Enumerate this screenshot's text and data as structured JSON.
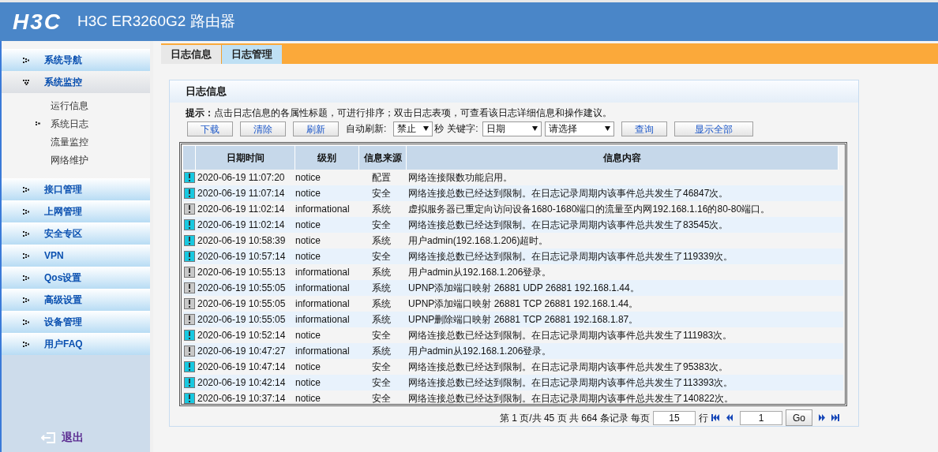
{
  "header": {
    "logo": "H3C",
    "title": "H3C ER3260G2 路由器"
  },
  "tabs": [
    {
      "label": "日志信息",
      "selected": true
    },
    {
      "label": "日志管理",
      "selected": false
    }
  ],
  "sidebar": {
    "items": [
      {
        "label": "系统导航",
        "expanded": false
      },
      {
        "label": "系统监控",
        "expanded": true,
        "children": [
          {
            "label": "运行信息",
            "selected": false
          },
          {
            "label": "系统日志",
            "selected": true
          },
          {
            "label": "流量监控",
            "selected": false
          },
          {
            "label": "网络维护",
            "selected": false
          }
        ]
      },
      {
        "label": "接口管理",
        "expanded": false
      },
      {
        "label": "上网管理",
        "expanded": false
      },
      {
        "label": "安全专区",
        "expanded": false
      },
      {
        "label": "VPN",
        "expanded": false
      },
      {
        "label": "Qos设置",
        "expanded": false
      },
      {
        "label": "高级设置",
        "expanded": false
      },
      {
        "label": "设备管理",
        "expanded": false
      },
      {
        "label": "用户FAQ",
        "expanded": false
      }
    ],
    "logout": "退出"
  },
  "panel": {
    "title": "日志信息",
    "hint": "**提示：**点击日志信息的各属性标题，可进行排序；双击日志表项，可查看该日志详细信息和操作建议。",
    "buttons": [
      "下载",
      "清除",
      "刷新"
    ],
    "auto_refresh_label": "自动刷新:",
    "auto_refresh_value": "禁止",
    "seconds_label": "秒",
    "keyword_label": "关键字:",
    "keyword_value": "日期",
    "condition_value": "请选择",
    "query_button": "查询",
    "show_all_button": "显示全部"
  },
  "table": {
    "columns": [
      "日期时间",
      "级别",
      "信息来源",
      "信息内容"
    ],
    "rows": [
      {
        "kind": "notice",
        "datetime": "2020-06-19 11:07:20",
        "severity": "notice",
        "source": "配置",
        "content": "网络连接限数功能启用。"
      },
      {
        "kind": "notice",
        "datetime": "2020-06-19 11:07:14",
        "severity": "notice",
        "source": "安全",
        "content": "网络连接总数已经达到限制。在日志记录周期内该事件总共发生了46847次。"
      },
      {
        "kind": "info",
        "datetime": "2020-06-19 11:02:14",
        "severity": "informational",
        "source": "系统",
        "content": "虚拟服务器已重定向访问设备1680-1680端口的流量至内网192.168.1.16的80-80端口。"
      },
      {
        "kind": "notice",
        "datetime": "2020-06-19 11:02:14",
        "severity": "notice",
        "source": "安全",
        "content": "网络连接总数已经达到限制。在日志记录周期内该事件总共发生了83545次。"
      },
      {
        "kind": "notice",
        "datetime": "2020-06-19 10:58:39",
        "severity": "notice",
        "source": "系统",
        "content": "用户admin(192.168.1.206)超时。"
      },
      {
        "kind": "notice",
        "datetime": "2020-06-19 10:57:14",
        "severity": "notice",
        "source": "安全",
        "content": "网络连接总数已经达到限制。在日志记录周期内该事件总共发生了119339次。"
      },
      {
        "kind": "info",
        "datetime": "2020-06-19 10:55:13",
        "severity": "informational",
        "source": "系统",
        "content": "用户admin从192.168.1.206登录。"
      },
      {
        "kind": "info",
        "datetime": "2020-06-19 10:55:05",
        "severity": "informational",
        "source": "系统",
        "content": "UPNP添加端口映射 26881 UDP 26881 192.168.1.44。"
      },
      {
        "kind": "info",
        "datetime": "2020-06-19 10:55:05",
        "severity": "informational",
        "source": "系统",
        "content": "UPNP添加端口映射 26881 TCP 26881 192.168.1.44。"
      },
      {
        "kind": "info",
        "datetime": "2020-06-19 10:55:05",
        "severity": "informational",
        "source": "系统",
        "content": "UPNP删除端口映射 26881 TCP 26881 192.168.1.87。"
      },
      {
        "kind": "notice",
        "datetime": "2020-06-19 10:52:14",
        "severity": "notice",
        "source": "安全",
        "content": "网络连接总数已经达到限制。在日志记录周期内该事件总共发生了111983次。"
      },
      {
        "kind": "info",
        "datetime": "2020-06-19 10:47:27",
        "severity": "informational",
        "source": "系统",
        "content": "用户admin从192.168.1.206登录。"
      },
      {
        "kind": "notice",
        "datetime": "2020-06-19 10:47:14",
        "severity": "notice",
        "source": "安全",
        "content": "网络连接总数已经达到限制。在日志记录周期内该事件总共发生了95383次。"
      },
      {
        "kind": "notice",
        "datetime": "2020-06-19 10:42:14",
        "severity": "notice",
        "source": "安全",
        "content": "网络连接总数已经达到限制。在日志记录周期内该事件总共发生了113393次。"
      },
      {
        "kind": "notice",
        "datetime": "2020-06-19 10:37:14",
        "severity": "notice",
        "source": "安全",
        "content": "网络连接总数已经达到限制。在日志记录周期内该事件总共发生了140822次。"
      }
    ]
  },
  "pagination": {
    "summary": "第 1 页/共 45 页 共 664 条记录 每页",
    "per_page": "15",
    "rows_label": "行",
    "page": "1",
    "go_button": "Go"
  }
}
